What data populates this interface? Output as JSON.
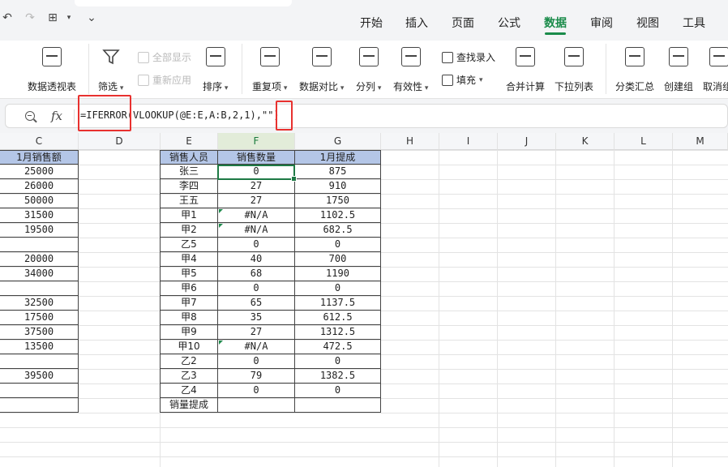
{
  "tabs": [
    "开始",
    "插入",
    "页面",
    "公式",
    "数据",
    "审阅",
    "视图",
    "工具"
  ],
  "active_tab": "数据",
  "ribbon": {
    "pivot": "数据透视表",
    "filter": "筛选",
    "show_all": "全部显示",
    "reapply": "重新应用",
    "sort": "排序",
    "duplicates": "重复项",
    "compare": "数据对比",
    "split": "分列",
    "validity": "有效性",
    "find_entry": "查找录入",
    "fill": "填充",
    "consolidate": "合并计算",
    "dropdown_list": "下拉列表",
    "subtotal": "分类汇总",
    "group": "创建组",
    "ungroup": "取消组合"
  },
  "formula_bar": {
    "fx": "fx",
    "formula": "=IFERROR(VLOOKUP(@E:E,A:B,2,1),\"\")"
  },
  "columns": [
    "C",
    "D",
    "E",
    "F",
    "G",
    "H",
    "I",
    "J",
    "K",
    "L",
    "M"
  ],
  "selected_column": "F",
  "col_c": {
    "header": "1月销售额",
    "values": [
      "25000",
      "26000",
      "50000",
      "31500",
      "19500",
      "",
      "20000",
      "34000",
      "",
      "32500",
      "17500",
      "37500",
      "13500",
      "",
      "39500",
      "",
      ""
    ]
  },
  "table": {
    "headers": [
      "销售人员",
      "销售数量",
      "1月提成"
    ],
    "rows": [
      [
        "张三",
        "0",
        "875"
      ],
      [
        "李四",
        "27",
        "910"
      ],
      [
        "王五",
        "27",
        "1750"
      ],
      [
        "甲1",
        "#N/A",
        "1102.5"
      ],
      [
        "甲2",
        "#N/A",
        "682.5"
      ],
      [
        "乙5",
        "0",
        "0"
      ],
      [
        "甲4",
        "40",
        "700"
      ],
      [
        "甲5",
        "68",
        "1190"
      ],
      [
        "甲6",
        "0",
        "0"
      ],
      [
        "甲7",
        "65",
        "1137.5"
      ],
      [
        "甲8",
        "35",
        "612.5"
      ],
      [
        "甲9",
        "27",
        "1312.5"
      ],
      [
        "甲10",
        "#N/A",
        "472.5"
      ],
      [
        "乙2",
        "0",
        "0"
      ],
      [
        "乙3",
        "79",
        "1382.5"
      ],
      [
        "乙4",
        "0",
        "0"
      ]
    ],
    "footer": [
      "销量提成",
      "",
      ""
    ]
  }
}
